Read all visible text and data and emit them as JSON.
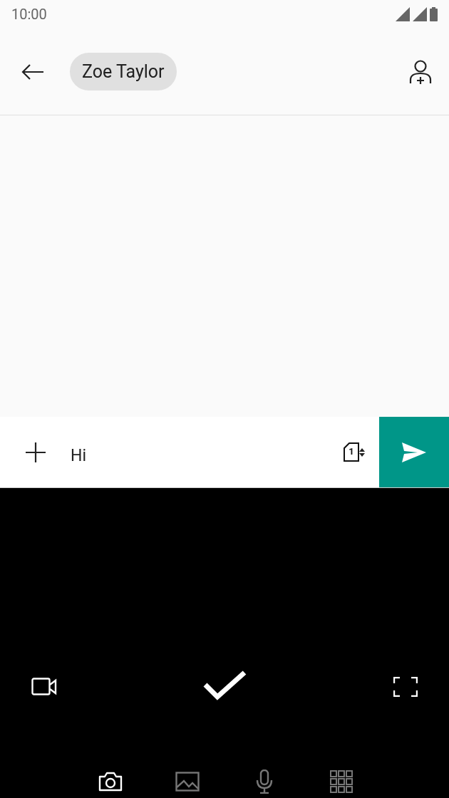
{
  "status_bar": {
    "time": "10:00"
  },
  "header": {
    "recipient": "Zoe Taylor"
  },
  "compose": {
    "value": "Hi",
    "sim": "1"
  },
  "attach_tabs": [
    {
      "kind": "camera",
      "selected": true
    },
    {
      "kind": "gallery",
      "selected": false
    },
    {
      "kind": "voice",
      "selected": false
    },
    {
      "kind": "more",
      "selected": false
    }
  ]
}
